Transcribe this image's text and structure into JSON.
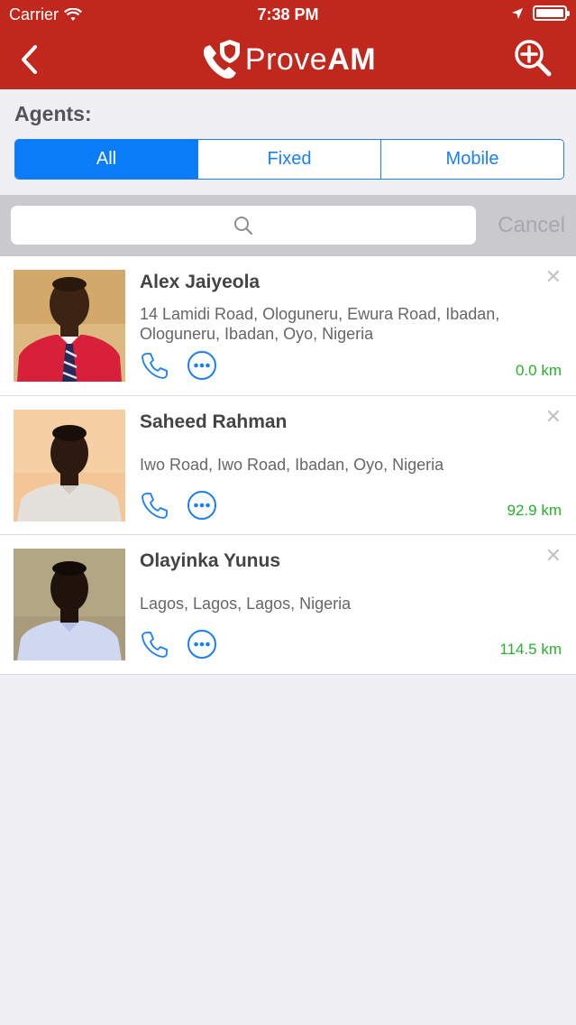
{
  "status_bar": {
    "carrier": "Carrier",
    "time": "7:38 PM"
  },
  "nav": {
    "app_name_light": "Prove",
    "app_name_bold": "AM"
  },
  "filter": {
    "label": "Agents:",
    "segments": [
      "All",
      "Fixed",
      "Mobile"
    ],
    "selected": "All"
  },
  "search": {
    "placeholder": "",
    "cancel_label": "Cancel"
  },
  "agents": [
    {
      "name": "Alex Jaiyeola",
      "address": "14 Lamidi Road, Ologuneru, Ewura Road, Ibadan, Ologuneru, Ibadan, Oyo, Nigeria",
      "distance": "0.0 km"
    },
    {
      "name": "Saheed Rahman",
      "address": "Iwo Road, Iwo Road, Ibadan, Oyo, Nigeria",
      "distance": "92.9 km"
    },
    {
      "name": "Olayinka Yunus",
      "address": "Lagos, Lagos, Lagos, Nigeria",
      "distance": "114.5 km"
    }
  ],
  "colors": {
    "brand_red": "#c0281d",
    "accent_blue": "#0a7cf8",
    "distance_green": "#2ab02a"
  },
  "icons": {
    "back": "chevron-left-icon",
    "zoom": "zoom-in-icon",
    "call": "phone-icon",
    "more": "more-icon",
    "close": "close-icon"
  }
}
